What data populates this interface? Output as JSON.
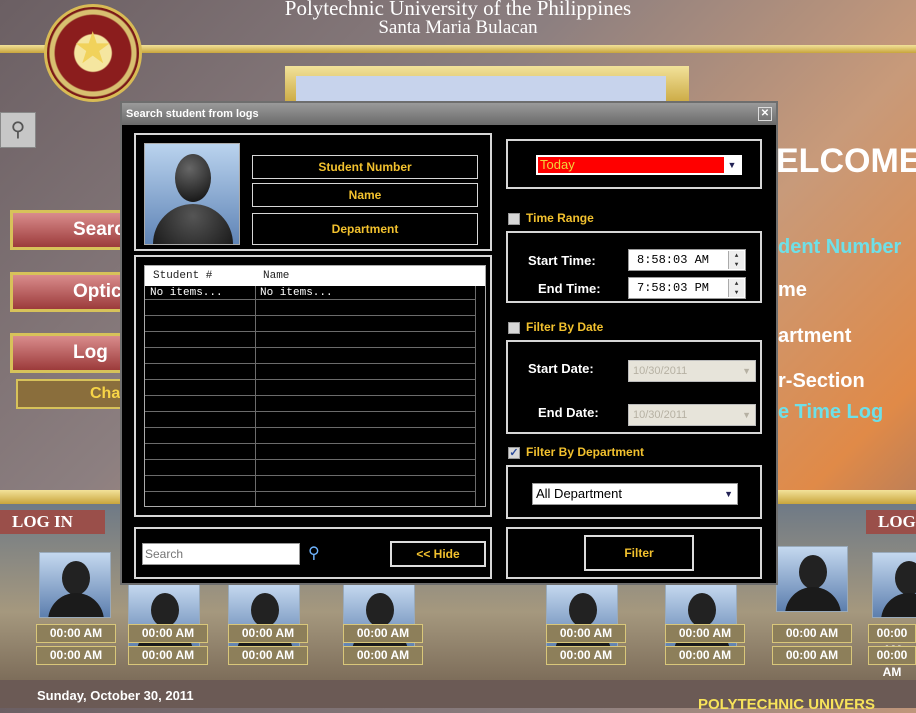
{
  "background": {
    "header_line1": "Polytechnic University of the Philippines",
    "header_line2": "Santa Maria Bulacan",
    "side_buttons": [
      "Searc",
      "Optic",
      "Log o"
    ],
    "chat_button": "Chat",
    "welcome": "ELCOME",
    "info_lines": [
      "dent Number",
      "me",
      "artment",
      "r-Section",
      "e Time Log"
    ],
    "login_left": "LOG IN",
    "login_right": "LOG",
    "time_in_label": "00:00 AM",
    "time_out_label": "00:00 AM",
    "date": "Sunday, October 30, 2011",
    "footer": "POLYTECHNIC UNIVERS"
  },
  "dialog": {
    "title": "Search student from logs",
    "close": "✕",
    "info": {
      "student_number": "Student Number",
      "name": "Name",
      "department": "Department"
    },
    "list": {
      "columns": [
        "Student #",
        "Name"
      ],
      "rows": [
        [
          "No items...",
          "No items..."
        ]
      ]
    },
    "search_placeholder": "Search",
    "hide_button": "<< Hide",
    "period_select": "Today",
    "time_range": {
      "label": "Time Range",
      "checked": false,
      "start_label": "Start Time:",
      "start_value": "8:58:03 AM",
      "end_label": "End Time:",
      "end_value": "7:58:03 PM"
    },
    "date_filter": {
      "label": "Filter By Date",
      "checked": false,
      "start_label": "Start Date:",
      "start_value": "10/30/2011",
      "end_label": "End Date:",
      "end_value": "10/30/2011"
    },
    "dept_filter": {
      "label": "Filter By Department",
      "checked": true,
      "value": "All Department"
    },
    "filter_button": "Filter"
  },
  "colors": {
    "accent_yellow": "#f2c12e",
    "select_red": "#ff0000"
  }
}
